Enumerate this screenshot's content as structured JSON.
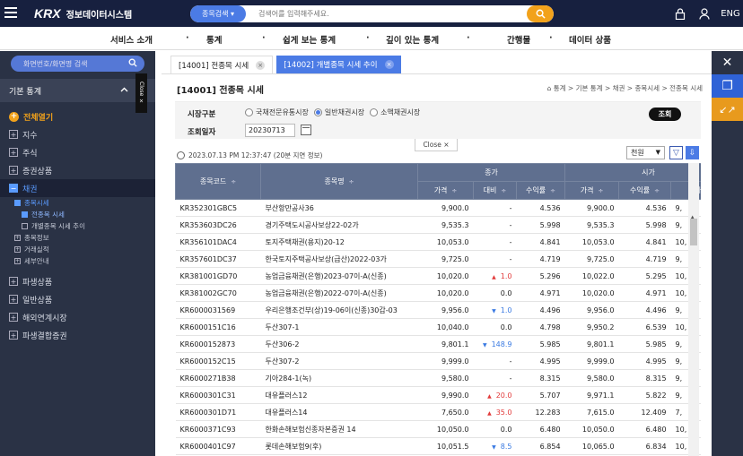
{
  "header": {
    "logo_mark": "KRX",
    "app_title": "정보데이터시스템",
    "search_scope": "종목검색",
    "search_placeholder": "검색어를 입력해주세요.",
    "lang_label": "ENG"
  },
  "nav": {
    "items": [
      "서비스 소개",
      "통계",
      "쉽게 보는 통계",
      "깊이 있는 통계",
      "간행물",
      "데이터 상품"
    ],
    "separator": "·"
  },
  "sidebar": {
    "search_label": "화면번호/화면명 검색",
    "section_title": "기본 통계",
    "close_label": "Close ×",
    "open_all": "전체열기",
    "items": [
      {
        "label": "지수"
      },
      {
        "label": "주식"
      },
      {
        "label": "증권상품"
      },
      {
        "label": "채권"
      }
    ],
    "bond_sub": {
      "group": "종목시세",
      "current": "전종목 시세",
      "other": "개별종목 시세 추이"
    },
    "bond_more": [
      "종목정보",
      "거래실적",
      "세부안내"
    ],
    "items_after": [
      {
        "label": "파생상품"
      },
      {
        "label": "일반상품"
      },
      {
        "label": "해외연계시장"
      },
      {
        "label": "파생결합증권"
      }
    ]
  },
  "tabs": [
    {
      "label": "[14001] 전종목 시세",
      "close": "×"
    },
    {
      "label": "[14002] 개별종목 시세 추이",
      "close": "×"
    }
  ],
  "page": {
    "title": "[14001] 전종목 시세",
    "breadcrumb": "통계 > 기본 통계 > 채권 > 종목시세 > 전종목 시세",
    "market_label": "시장구분",
    "markets": [
      "국채전문유통시장",
      "일반채권시장",
      "소액채권시장"
    ],
    "selected_market": "일반채권시장",
    "date_label": "조회일자",
    "date_value": "20230713",
    "query_button": "조회",
    "close_pill": "Close ×",
    "timestamp": "2023.07.13 PM 12:37:47 (20분 지연 정보)",
    "unit": "천원"
  },
  "table": {
    "group_headers": {
      "close": "종가",
      "open": "시가"
    },
    "columns": [
      "종목코드",
      "종목명",
      "가격",
      "대비",
      "수익률",
      "가격",
      "수익률",
      "가격"
    ],
    "sort_glyph": "÷",
    "rows": [
      [
        "KR352301GBC5",
        "부산항만공사36",
        "9,900.0",
        "",
        "-",
        "4.536",
        "9,900.0",
        "4.536",
        "9,"
      ],
      [
        "KR353603DC26",
        "경기주택도시공사보상22-02가",
        "9,535.3",
        "",
        "-",
        "5.998",
        "9,535.3",
        "5.998",
        "9,"
      ],
      [
        "KR356101DAC4",
        "토지주택채권(용지)20-12",
        "10,053.0",
        "",
        "-",
        "4.841",
        "10,053.0",
        "4.841",
        "10,"
      ],
      [
        "KR357601DC37",
        "한국토지주택공사보상(급산)2022-03가",
        "9,725.0",
        "",
        "-",
        "4.719",
        "9,725.0",
        "4.719",
        "9,"
      ],
      [
        "KR381001GD70",
        "농업금융채권(은행)2023-07이-A(신종)",
        "10,020.0",
        "up",
        "1.0",
        "5.296",
        "10,022.0",
        "5.295",
        "10,"
      ],
      [
        "KR381002GC70",
        "농업금융채권(은행)2022-07이-A(신종)",
        "10,020.0",
        "",
        "0.0",
        "4.971",
        "10,020.0",
        "4.971",
        "10,"
      ],
      [
        "KR6000031569",
        "우리은행조건부(상)19-06이(신종)30갑-03",
        "9,956.0",
        "dn",
        "1.0",
        "4.496",
        "9,956.0",
        "4.496",
        "9,"
      ],
      [
        "KR6000151C16",
        "두산307-1",
        "10,040.0",
        "",
        "0.0",
        "4.798",
        "9,950.2",
        "6.539",
        "10,"
      ],
      [
        "KR6000152873",
        "두산306-2",
        "9,801.1",
        "dn",
        "148.9",
        "5.985",
        "9,801.1",
        "5.985",
        "9,"
      ],
      [
        "KR6000152C15",
        "두산307-2",
        "9,999.0",
        "",
        "-",
        "4.995",
        "9,999.0",
        "4.995",
        "9,"
      ],
      [
        "KR6000271B38",
        "기아284-1(녹)",
        "9,580.0",
        "",
        "-",
        "8.315",
        "9,580.0",
        "8.315",
        "9,"
      ],
      [
        "KR6000301C31",
        "대유플러스12",
        "9,990.0",
        "up",
        "20.0",
        "5.707",
        "9,971.1",
        "5.822",
        "9,"
      ],
      [
        "KR6000301D71",
        "대유플러스14",
        "7,650.0",
        "up",
        "35.0",
        "12.283",
        "7,615.0",
        "12.409",
        "7,"
      ],
      [
        "KR6000371C93",
        "한화손해보험신종자본증권 14",
        "10,050.0",
        "",
        "0.0",
        "6.480",
        "10,050.0",
        "6.480",
        "10,"
      ],
      [
        "KR6000401C97",
        "롯데손해보험9(후)",
        "10,051.5",
        "dn",
        "8.5",
        "6.854",
        "10,065.0",
        "6.834",
        "10,"
      ]
    ]
  },
  "colors": {
    "topbar": "#17203f",
    "accent_blue": "#4b7be5",
    "accent_orange": "#f2a21b",
    "up": "#e23a3a",
    "down": "#3a7ae2"
  }
}
